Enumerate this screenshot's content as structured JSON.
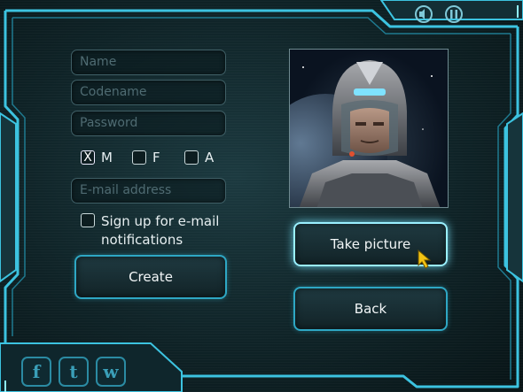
{
  "form": {
    "name_placeholder": "Name",
    "codename_placeholder": "Codename",
    "password_placeholder": "Password",
    "email_placeholder": "E-mail address",
    "gender": {
      "options": [
        {
          "label": "M",
          "checked": true,
          "mark": "X"
        },
        {
          "label": "F",
          "checked": false
        },
        {
          "label": "A",
          "checked": false
        }
      ]
    },
    "newsletter_label_line1": "Sign up for e-mail",
    "newsletter_label_line2": "notifications",
    "create_label": "Create"
  },
  "photo": {
    "take_picture_label": "Take picture",
    "back_label": "Back"
  },
  "social": {
    "facebook_glyph": "f",
    "twitter_glyph": "t",
    "w_glyph": "w"
  },
  "colors": {
    "accent": "#2ea7c4",
    "frame": "#3cc3e0",
    "background": "#0f2327"
  }
}
